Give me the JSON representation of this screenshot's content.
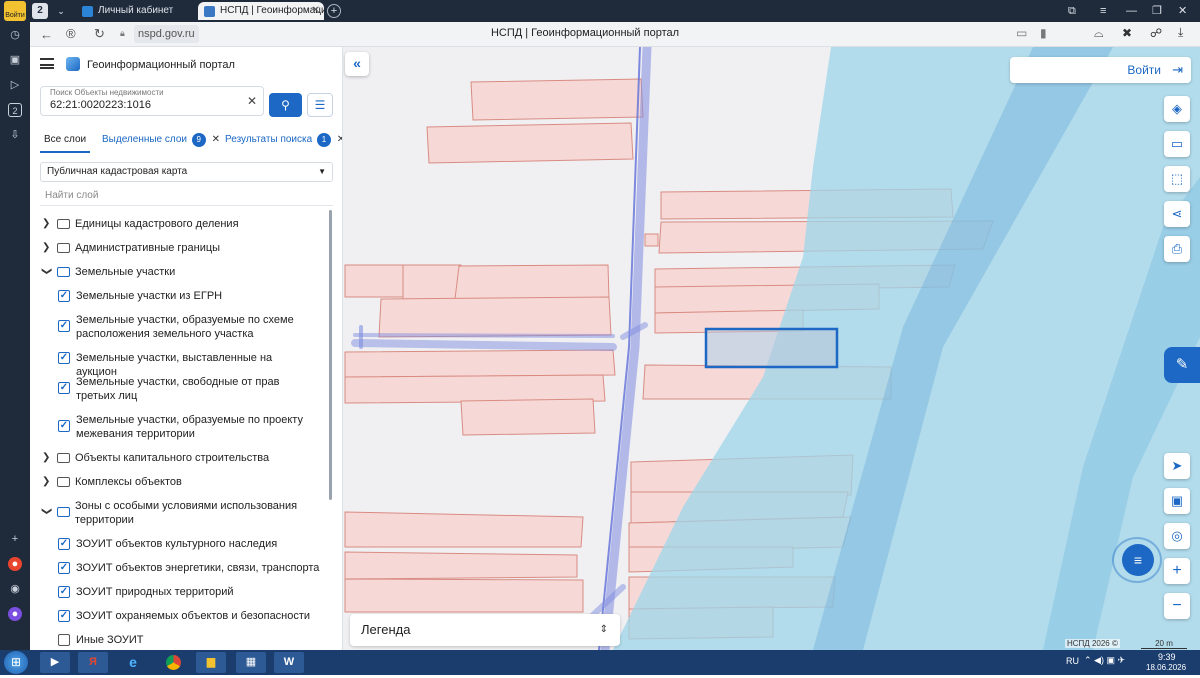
{
  "browser": {
    "tab_count": "2",
    "login_badge": "Войти",
    "tabs": [
      {
        "label": "Личный кабинет"
      },
      {
        "label": "НСПД | Геоинформаци"
      }
    ],
    "address": "nspd.gov.ru",
    "page_title": "НСПД | Геоинформационный портал"
  },
  "sidebar": {
    "app_title": "Геоинформационный портал",
    "search": {
      "label": "Поиск Объекты недвижимости",
      "value": "62:21:0020223:1016"
    },
    "tabs": [
      {
        "label": "Все слои",
        "badge": ""
      },
      {
        "label": "Выделенные слои",
        "badge": "9"
      },
      {
        "label": "Результаты поиска",
        "badge": "1"
      }
    ],
    "map_select": "Публичная кадастровая карта",
    "find_layer_placeholder": "Найти слой",
    "tree": [
      {
        "label": "Единицы кадастрового деления",
        "kind": "folder",
        "state": "collapsed"
      },
      {
        "label": "Административные границы",
        "kind": "folder",
        "state": "collapsed"
      },
      {
        "label": "Земельные участки",
        "kind": "folder",
        "state": "expanded"
      },
      {
        "label": "Земельные участки из ЕГРН",
        "kind": "layer",
        "checked": true
      },
      {
        "label": "Земельные участки, образуемые по схеме расположения земельного участка",
        "kind": "layer",
        "checked": true
      },
      {
        "label": "Земельные участки, выставленные на аукцион",
        "kind": "layer",
        "checked": true
      },
      {
        "label": "Земельные участки, свободные от прав третьих лиц",
        "kind": "layer",
        "checked": true
      },
      {
        "label": "Земельные участки, образуемые по проекту межевания территории",
        "kind": "layer",
        "checked": true
      },
      {
        "label": "Объекты капитального строительства",
        "kind": "folder",
        "state": "collapsed"
      },
      {
        "label": "Комплексы объектов",
        "kind": "folder",
        "state": "collapsed"
      },
      {
        "label": "Зоны с особыми условиями использования территории",
        "kind": "folder",
        "state": "expanded"
      },
      {
        "label": "ЗОУИТ объектов культурного наследия",
        "kind": "layer",
        "checked": true
      },
      {
        "label": "ЗОУИТ объектов энергетики, связи, транспорта",
        "kind": "layer",
        "checked": true
      },
      {
        "label": "ЗОУИТ природных территорий",
        "kind": "layer",
        "checked": true
      },
      {
        "label": "ЗОУИТ охраняемых объектов и безопасности",
        "kind": "layer",
        "checked": true
      },
      {
        "label": "Иные ЗОУИТ",
        "kind": "layer",
        "checked": false
      }
    ]
  },
  "map": {
    "login_button": "Войти",
    "legend_label": "Легенда",
    "attribution": "НСПД 2026 ©",
    "scale_label": "20 m",
    "colors": {
      "parcel_fill": "#f6d9d6",
      "parcel_stroke": "#d98b83",
      "water": "#9ed6ea",
      "selection": "#1c68c4"
    }
  },
  "taskbar": {
    "lang": "RU",
    "time": "9:39",
    "date": "18.06.2026"
  }
}
